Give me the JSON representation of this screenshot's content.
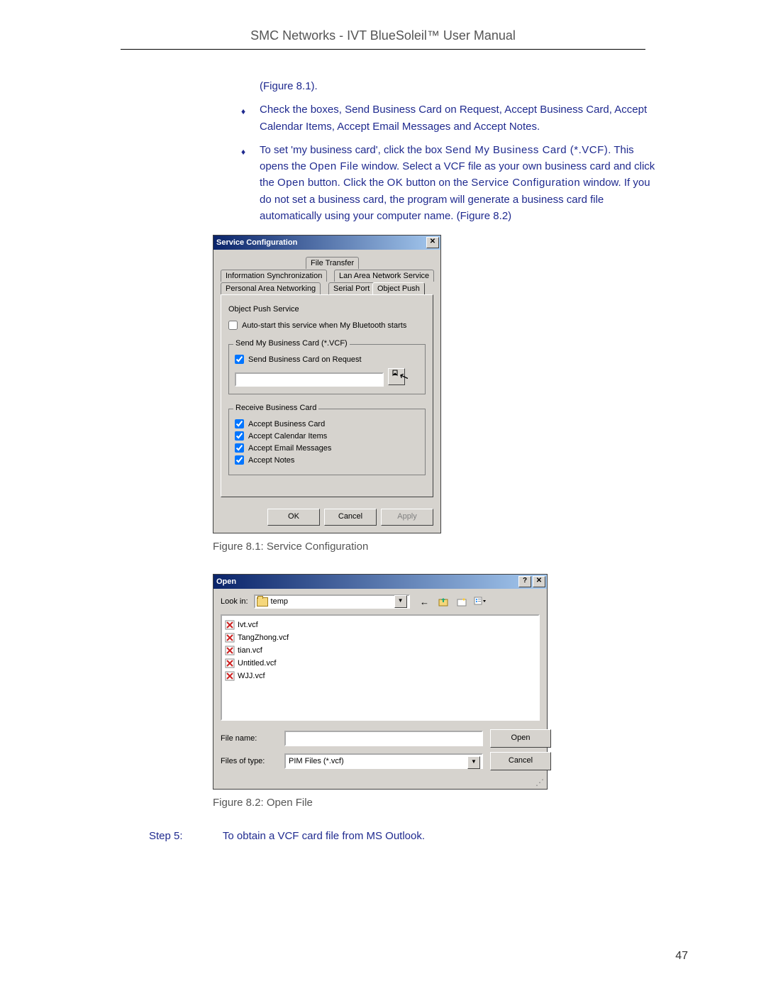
{
  "header": "SMC Networks - IVT BlueSoleil™ User Manual",
  "page_number": "47",
  "body": {
    "figref": "(Figure 8.1).",
    "bullet1": "Check the boxes, Send Business Card on Request, Accept Business Card, Accept Calendar Items, Accept Email Messages and Accept Notes.",
    "bullet2_a": "To set 'my business card', click the box ",
    "bullet2_b": "Send My Business Card (*.VCF)",
    "bullet2_c": ". This opens the ",
    "bullet2_d": "Open File",
    "bullet2_e": " window. Select a VCF file as your own business card and click the ",
    "bullet2_f": "Open",
    "bullet2_g": " button. Click the ",
    "bullet2_h": "OK",
    "bullet2_i": " button on the ",
    "bullet2_j": "Service Configuration",
    "bullet2_k": " window. If you do not set a business card, the program will generate a business card file automatically using your computer name. (Figure 8.2)"
  },
  "svc": {
    "title": "Service Configuration",
    "tabs": {
      "file_transfer": "File Transfer",
      "info_sync": "Information Synchronization",
      "lan": "Lan Area Network Service",
      "pan": "Personal Area Networking",
      "serial": "Serial Port",
      "object_push": "Object Push"
    },
    "panel_label": "Object Push Service",
    "autostart": "Auto-start this service when My Bluetooth starts",
    "group1_legend": "Send My Business Card (*.VCF)",
    "send_on_request": "Send Business Card on Request",
    "input_value": "",
    "group2_legend": "Receive Business Card",
    "accept_card": "Accept Business Card",
    "accept_cal": "Accept Calendar Items",
    "accept_email": "Accept Email Messages",
    "accept_notes": "Accept Notes",
    "ok": "OK",
    "cancel": "Cancel",
    "apply": "Apply"
  },
  "caption1": "Figure 8.1: Service Configuration",
  "open": {
    "title": "Open",
    "lookin_label": "Look in:",
    "lookin_value": "temp",
    "files": [
      "Ivt.vcf",
      "TangZhong.vcf",
      "tian.vcf",
      "Untitled.vcf",
      "WJJ.vcf"
    ],
    "filename_label": "File name:",
    "filename_value": "",
    "filetype_label": "Files of type:",
    "filetype_value": "PIM Files (*.vcf)",
    "open_btn": "Open",
    "cancel_btn": "Cancel"
  },
  "caption2": "Figure 8.2: Open File",
  "step": {
    "label": "Step 5:",
    "text": "To obtain a VCF card file from MS Outlook."
  }
}
